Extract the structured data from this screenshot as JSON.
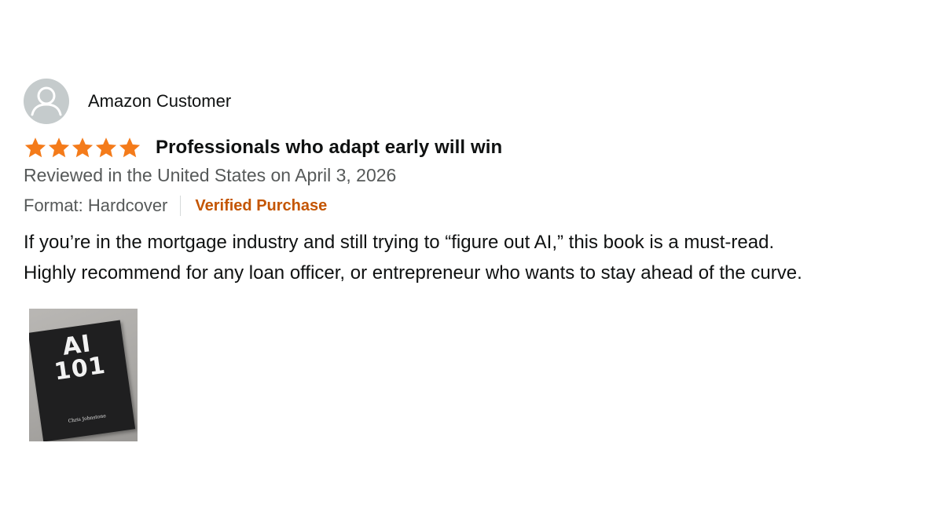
{
  "review": {
    "profile": {
      "name": "Amazon Customer",
      "avatar_icon": "user-avatar-icon"
    },
    "rating": {
      "stars": 5,
      "max": 5,
      "color": "#f47b1a",
      "icon": "star-icon"
    },
    "title": "Professionals who adapt early will win",
    "date": "Reviewed in the United States on April 3, 2026",
    "format": "Format: Hardcover",
    "verified": "Verified Purchase",
    "body": [
      "If you’re in the mortgage industry and still trying to “figure out AI,” this book is a must-read.",
      "Highly recommend for any loan officer, or entrepreneur who wants to stay ahead of the curve."
    ],
    "image": {
      "book_title_line1": "AI",
      "book_title_line2": "101",
      "book_author": "Chris Johnstone"
    },
    "colors": {
      "verified": "#c45500",
      "secondary_text": "#565959",
      "primary_text": "#0f1111"
    }
  }
}
